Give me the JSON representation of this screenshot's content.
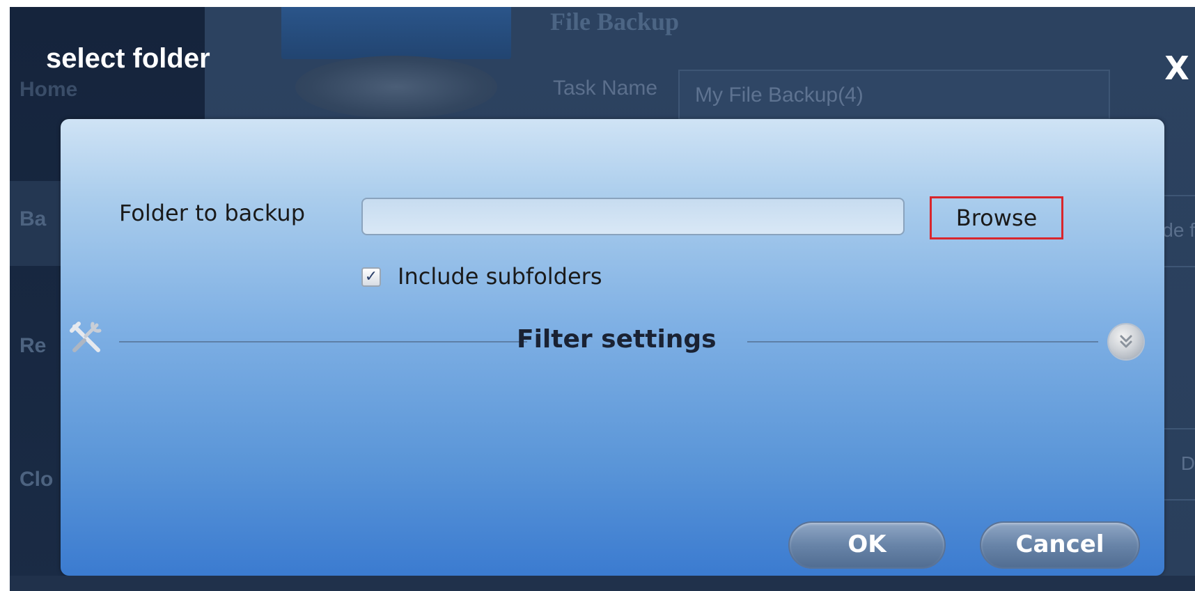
{
  "background": {
    "sidebar": {
      "items": [
        {
          "label": "Home"
        },
        {
          "label": "Ba"
        },
        {
          "label": "Re"
        },
        {
          "label": "Clo"
        }
      ]
    },
    "main": {
      "title": "File Backup",
      "task_name_label": "Task Name",
      "task_name_value": "My File Backup(4)",
      "right_fragment_1": "de f",
      "right_fragment_2": "D"
    }
  },
  "dialog": {
    "title": "select folder",
    "close_label": "X",
    "folder_label": "Folder to backup",
    "folder_value": "",
    "browse_label": "Browse",
    "include_subfolders": {
      "label": "Include subfolders",
      "checked": true,
      "mark": "✓"
    },
    "filter_settings_title": "Filter settings",
    "ok_label": "OK",
    "cancel_label": "Cancel"
  },
  "colors": {
    "highlight": "#d9262c",
    "panel_top": "#cfe3f5",
    "panel_bottom": "#3b7bd0"
  }
}
